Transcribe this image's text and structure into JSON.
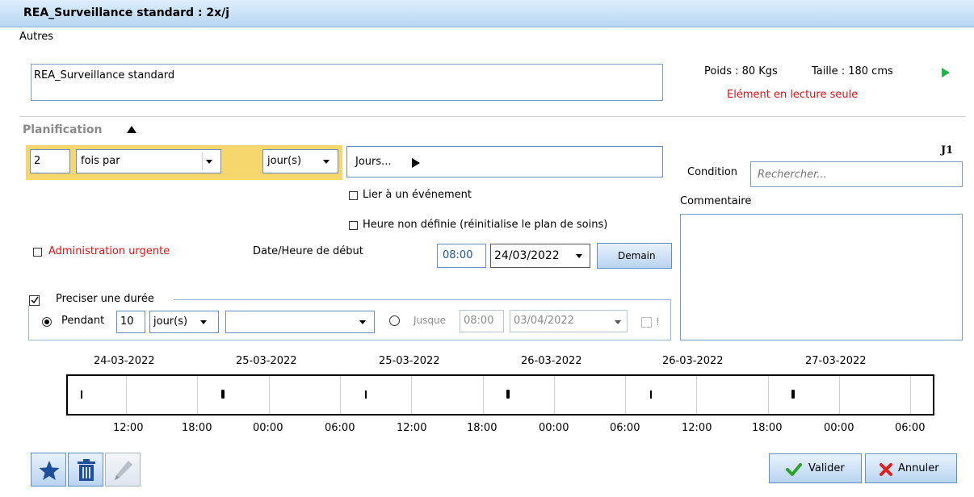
{
  "window": {
    "title": "REA_Surveillance standard : 2x/j"
  },
  "autres": {
    "label": "Autres",
    "value": "REA_Surveillance standard"
  },
  "patient": {
    "poids": "Poids : 80 Kgs",
    "taille": "Taille : 180 cms",
    "readonly": "Elément en lecture seule",
    "play_icon": "play-icon"
  },
  "planification": {
    "label": "Planification",
    "count": "2",
    "freq": "fois par",
    "unit": "jour(s)",
    "jours": "Jours...",
    "j1": "J1",
    "lier": "Lier à un événement",
    "heure_non_definie": "Heure non définie (réinitialise le plan de soins)",
    "admin_urgente": "Administration urgente",
    "date_debut_label": "Date/Heure de début",
    "start_time": "08:00",
    "start_date": "24/03/2022",
    "demain": "Demain",
    "condition_label": "Condition",
    "condition_placeholder": "Rechercher...",
    "commentaire_label": "Commentaire"
  },
  "duree": {
    "legend": "Preciser une durée",
    "pendant": "Pendant",
    "pendant_value": "10",
    "pendant_unit": "jour(s)",
    "extra_select": "",
    "jusque": "Jusque",
    "jusque_time": "08:00",
    "jusque_date": "03/04/2022",
    "excl": "!"
  },
  "timeline": {
    "dates": [
      "24-03-2022",
      "25-03-2022",
      "25-03-2022",
      "26-03-2022",
      "26-03-2022",
      "27-03-2022"
    ],
    "hours": [
      "12:00",
      "18:00",
      "00:00",
      "06:00",
      "12:00",
      "18:00",
      "00:00",
      "06:00",
      "12:00",
      "18:00",
      "00:00",
      "06:00"
    ]
  },
  "toolbar": {
    "valider": "Valider",
    "annuler": "Annuler"
  },
  "colors": {
    "accent": "#f5d76e",
    "title_bg": "#c4ddf6",
    "red": "#e01010",
    "play": "#22b14c"
  }
}
